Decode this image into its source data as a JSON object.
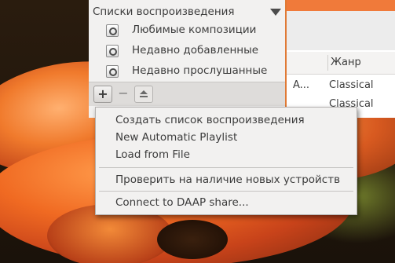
{
  "sidebar": {
    "header": "Списки воспроизведения",
    "items": [
      {
        "label": "Любимые композиции"
      },
      {
        "label": "Недавно добавленные"
      },
      {
        "label": "Недавно прослушанные"
      }
    ]
  },
  "toolbar": {
    "add_label": "+",
    "remove_label": "−"
  },
  "table": {
    "columns": {
      "genre": "Жанр"
    },
    "rows": [
      {
        "title": "A...",
        "genre": "Classical"
      },
      {
        "title": "",
        "genre": "Classical"
      }
    ]
  },
  "menu": {
    "items": [
      {
        "label": "Создать список воспроизведения"
      },
      {
        "label": "New Automatic Playlist"
      },
      {
        "label": "Load from File"
      },
      {
        "label": "Проверить на наличие новых устройств"
      },
      {
        "label": "Connect to DAAP share..."
      }
    ]
  },
  "colors": {
    "accent": "#e07a35",
    "menu_bg": "#f2f1f0"
  }
}
